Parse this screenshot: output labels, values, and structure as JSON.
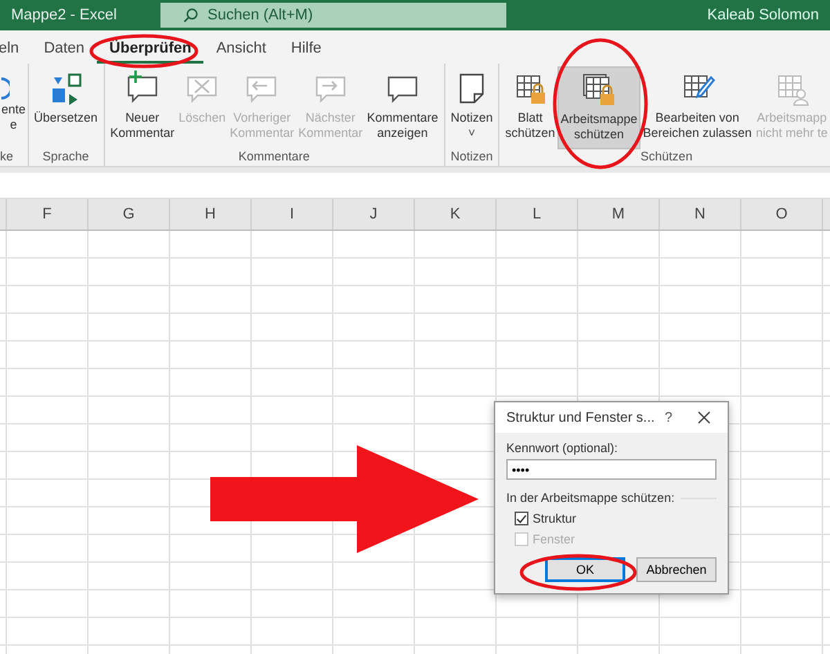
{
  "title_bar": {
    "title": "Mappe2 - Excel",
    "search_placeholder": "Suchen (Alt+M)",
    "user": "Kaleab Solomon"
  },
  "tabs": [
    {
      "label": "eln",
      "selected": false
    },
    {
      "label": "Daten",
      "selected": false
    },
    {
      "label": "Überprüfen",
      "selected": true
    },
    {
      "label": "Ansicht",
      "selected": false
    },
    {
      "label": "Hilfe",
      "selected": false
    }
  ],
  "ribbon": {
    "groups": [
      {
        "label": "ke",
        "items": [
          {
            "label": "ente\ne",
            "disabled": false,
            "selected": false
          }
        ]
      },
      {
        "label": "Sprache",
        "items": [
          {
            "label": "Übersetzen",
            "disabled": false,
            "selected": false
          }
        ]
      },
      {
        "label": "Kommentare",
        "items": [
          {
            "label": "Neuer\nKommentar",
            "disabled": false,
            "selected": false
          },
          {
            "label": "Löschen",
            "disabled": true,
            "selected": false
          },
          {
            "label": "Vorheriger\nKommentar",
            "disabled": true,
            "selected": false
          },
          {
            "label": "Nächster\nKommentar",
            "disabled": true,
            "selected": false
          },
          {
            "label": "Kommentare\nanzeigen",
            "disabled": false,
            "selected": false
          }
        ]
      },
      {
        "label": "Notizen",
        "items": [
          {
            "label": "Notizen",
            "caret": "˅",
            "disabled": false,
            "selected": false
          }
        ]
      },
      {
        "label": "Schützen",
        "items": [
          {
            "label": "Blatt\nschützen",
            "disabled": false,
            "selected": false
          },
          {
            "label": "Arbeitsmappe\nschützen",
            "disabled": false,
            "selected": true
          },
          {
            "label": "Bearbeiten von\nBereichen zulassen",
            "disabled": false,
            "selected": false
          },
          {
            "label": "Arbeitsmapp\nnicht mehr te",
            "disabled": true,
            "selected": false
          }
        ]
      }
    ]
  },
  "sheet": {
    "columns": [
      "F",
      "G",
      "H",
      "I",
      "J",
      "K",
      "L",
      "M",
      "N",
      "O"
    ]
  },
  "dialog": {
    "title": "Struktur und Fenster s...",
    "help": "?",
    "password_label": "Kennwort (optional):",
    "password_value": "••••",
    "section_label": "In der Arbeitsmappe schützen:",
    "options": [
      {
        "label": "Struktur",
        "checked": true,
        "disabled": false
      },
      {
        "label": "Fenster",
        "checked": false,
        "disabled": true
      }
    ],
    "buttons": [
      {
        "label": "OK",
        "default": true
      },
      {
        "label": "Abbrechen",
        "default": false
      }
    ]
  }
}
